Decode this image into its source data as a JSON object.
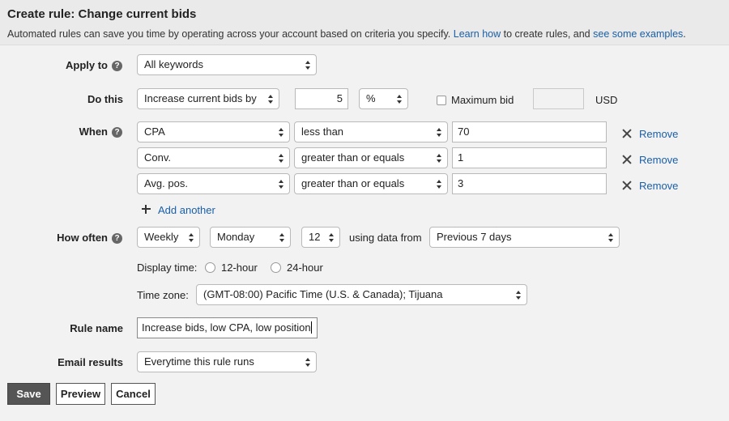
{
  "header": {
    "title": "Create rule: Change current bids",
    "desc_before": "Automated rules can save you time by operating across your account based on criteria you specify.",
    "learn_how": "Learn how",
    "desc_mid": "to create rules, and",
    "see_examples": "see some examples",
    "desc_end": "."
  },
  "apply_to": {
    "label": "Apply to",
    "value": "All keywords"
  },
  "do_this": {
    "label": "Do this",
    "action": "Increase current bids by",
    "amount": "5",
    "unit": "%",
    "max_bid_label": "Maximum bid",
    "max_bid_value": "",
    "currency": "USD"
  },
  "when": {
    "label": "When",
    "conditions": [
      {
        "metric": "CPA",
        "operator": "less than",
        "value": "70"
      },
      {
        "metric": "Conv.",
        "operator": "greater than or equals",
        "value": "1"
      },
      {
        "metric": "Avg. pos.",
        "operator": "greater than or equals",
        "value": "3"
      }
    ],
    "remove_label": "Remove",
    "add_another": "Add another"
  },
  "how_often": {
    "label": "How often",
    "frequency": "Weekly",
    "day": "Monday",
    "hour": "12",
    "using_data_from": "using data from",
    "range": "Previous 7 days",
    "display_time_label": "Display time:",
    "option_12": "12-hour",
    "option_24": "24-hour",
    "time_zone_label": "Time zone:",
    "time_zone": "(GMT-08:00) Pacific Time (U.S. & Canada); Tijuana"
  },
  "rule_name": {
    "label": "Rule name",
    "value": "Increase bids, low CPA, low position"
  },
  "email_results": {
    "label": "Email results",
    "value": "Everytime this rule runs"
  },
  "buttons": {
    "save": "Save",
    "preview": "Preview",
    "cancel": "Cancel"
  },
  "colors": {
    "link": "#1a5fa8",
    "primary_button": "#555555"
  }
}
